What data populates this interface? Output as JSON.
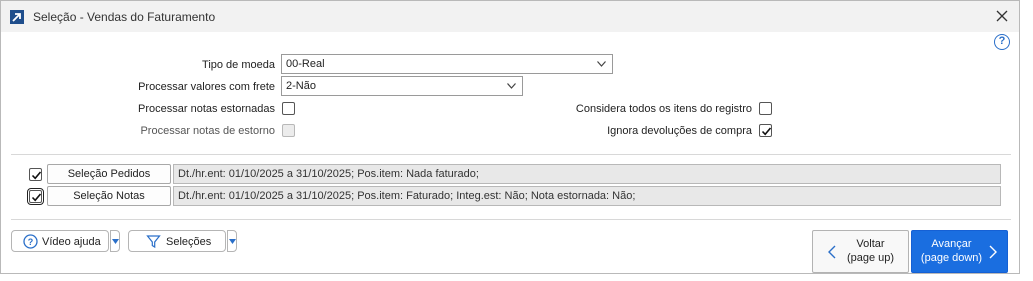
{
  "window": {
    "title": "Seleção - Vendas do Faturamento",
    "icon": "arrow-up-right-icon",
    "close_icon": "close-icon",
    "help_icon_text": "?"
  },
  "form": {
    "tipo_moeda": {
      "label": "Tipo de moeda",
      "value": "00-Real"
    },
    "processar_frete": {
      "label": "Processar valores com frete",
      "value": "2-Não"
    },
    "processar_estornadas": {
      "label": "Processar notas estornadas",
      "checked": false
    },
    "processar_estorno": {
      "label": "Processar notas de estorno",
      "checked": false,
      "disabled": true
    },
    "considera_itens": {
      "label": "Considera todos os itens do registro",
      "checked": false
    },
    "ignora_devolucoes": {
      "label": "Ignora devoluções de compra",
      "checked": true
    }
  },
  "selections": [
    {
      "checked": true,
      "button_label": "Seleção Pedidos",
      "summary": "Dt./hr.ent: 01/10/2025 a 31/10/2025; Pos.item: Nada faturado;"
    },
    {
      "checked": true,
      "button_label": "Seleção Notas",
      "summary": "Dt./hr.ent: 01/10/2025 a 31/10/2025; Pos.item: Faturado; Integ.est: Não; Nota estornada: Não;"
    }
  ],
  "footer": {
    "video_ajuda": "Vídeo ajuda",
    "selecoes": "Seleções",
    "voltar": "Voltar",
    "voltar_hint": "(page up)",
    "avancar": "Avançar",
    "avancar_hint": "(page down)"
  },
  "colors": {
    "accent": "#1a6ee0",
    "title_bar": "#f2f2f2",
    "help": "#2a6fc9"
  }
}
